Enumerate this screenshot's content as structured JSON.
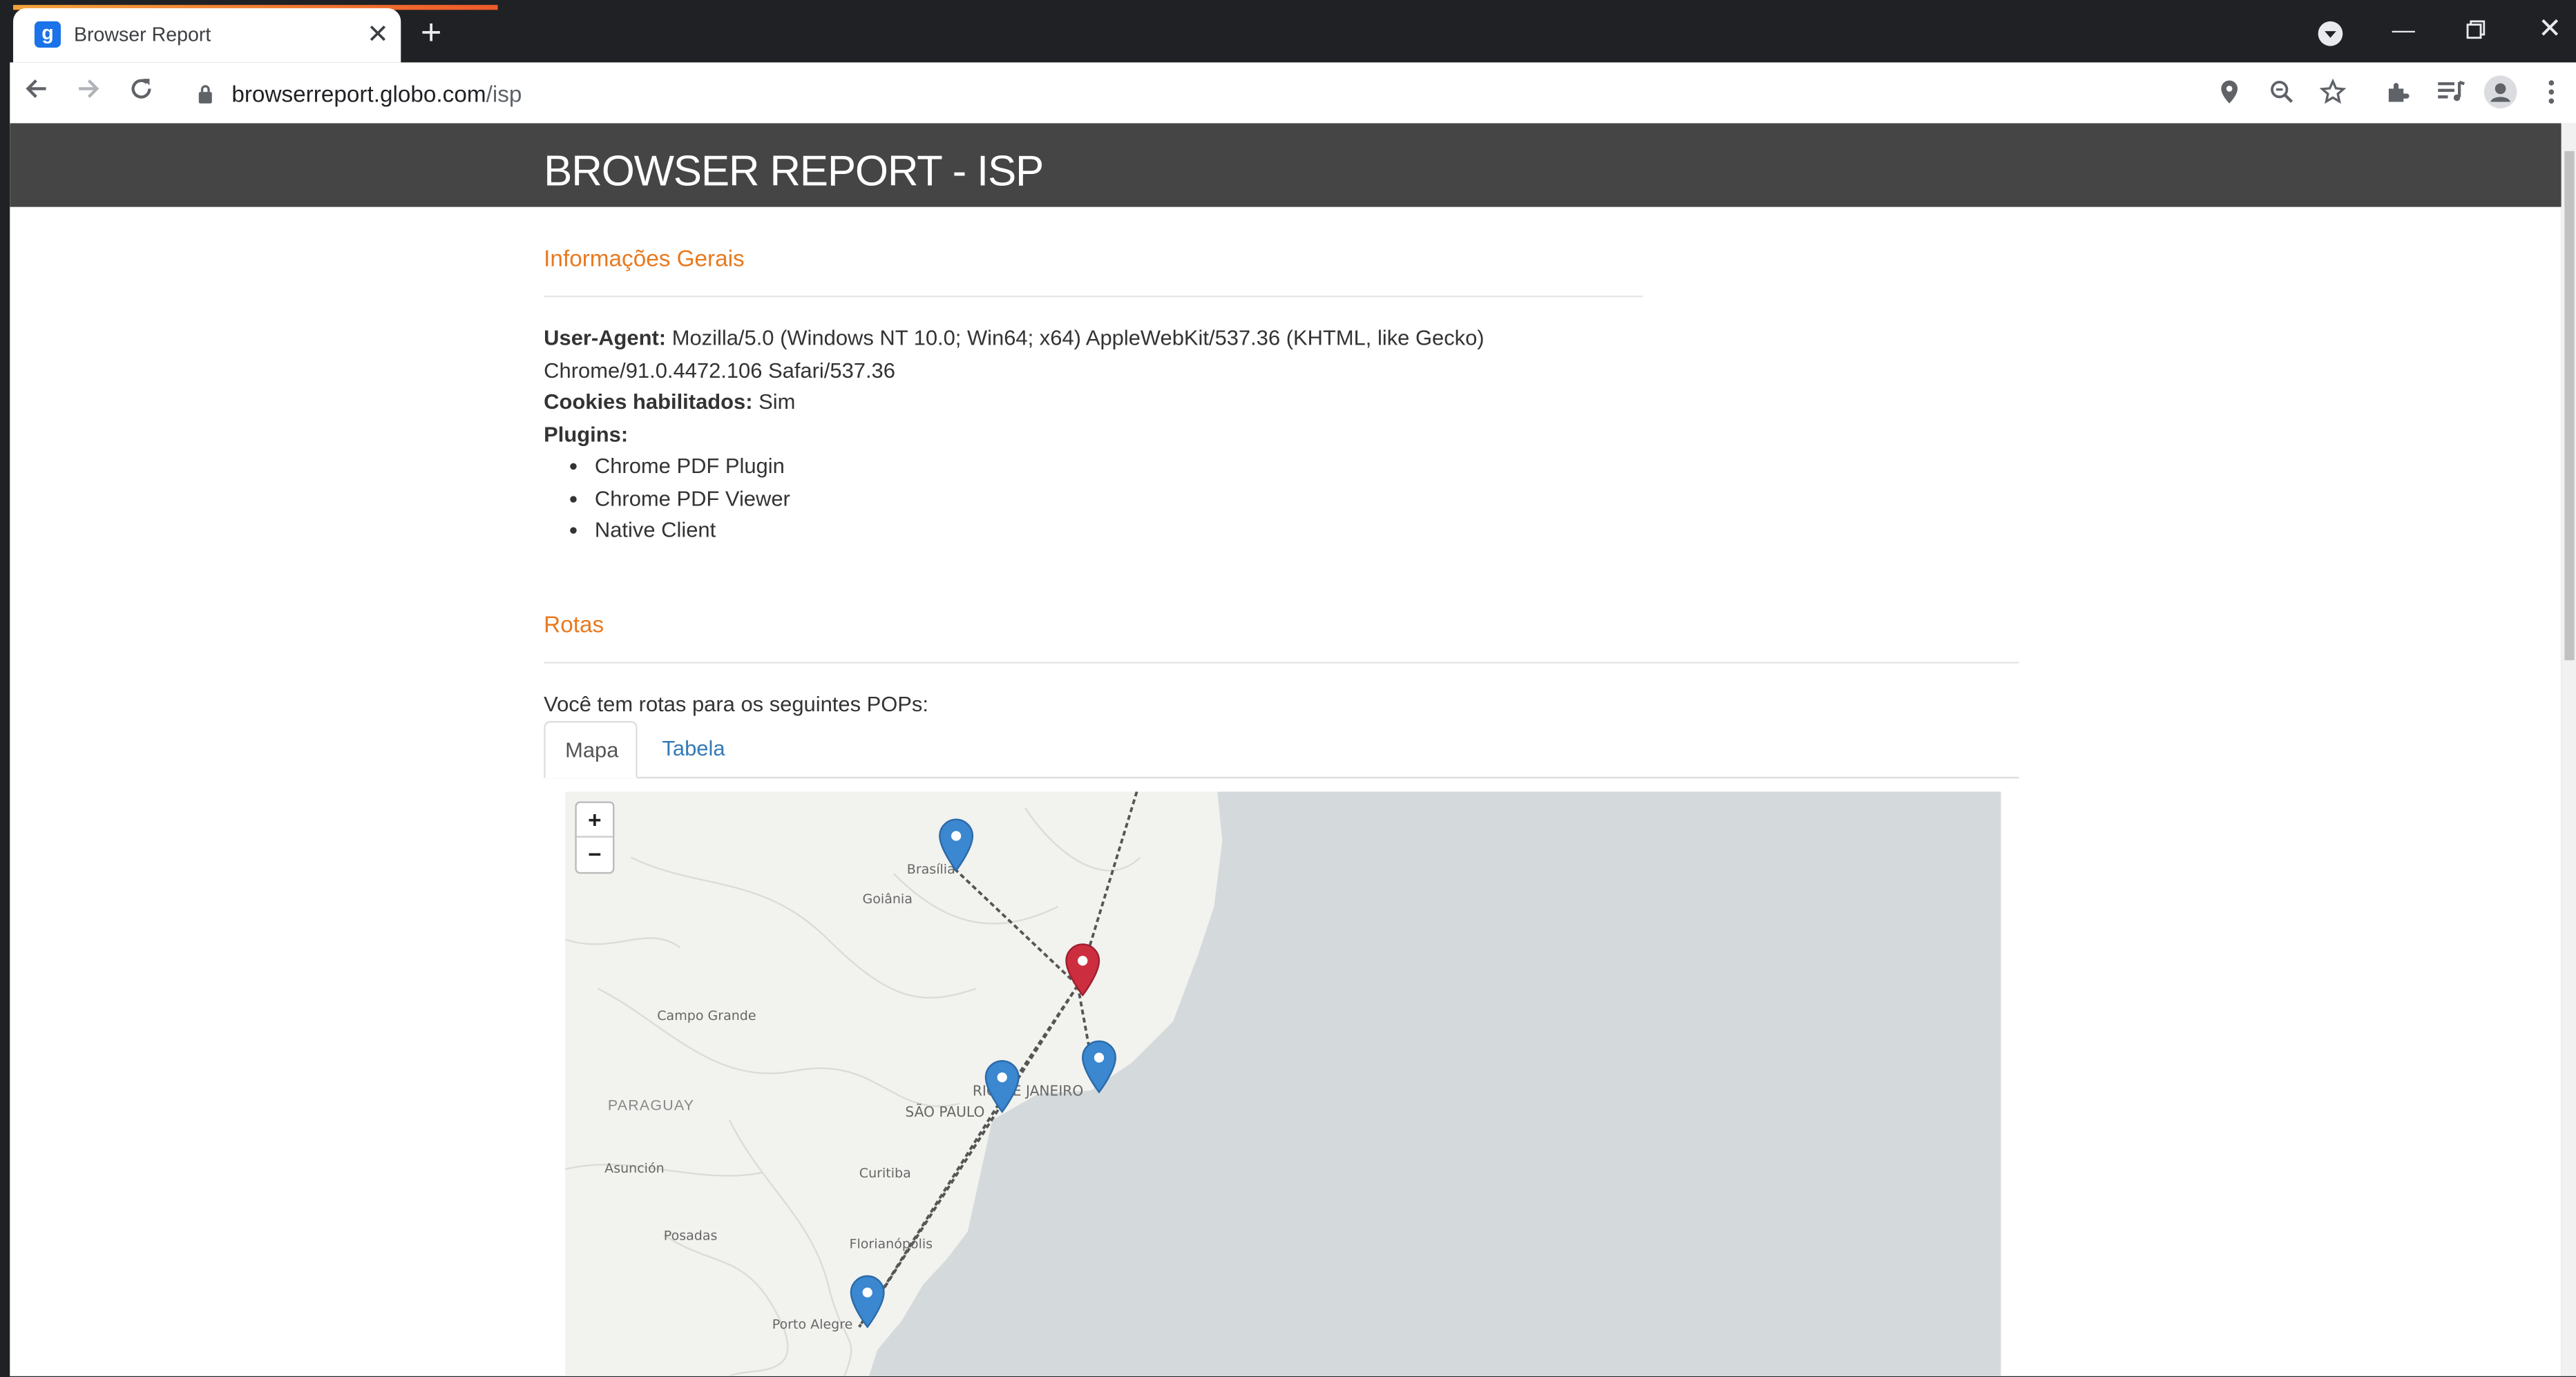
{
  "browser": {
    "tab_title": "Browser Report",
    "favicon_letter": "g",
    "url_host": "browserreport.globo.com",
    "url_path": "/isp"
  },
  "page": {
    "banner_title": "BROWSER REPORT - ISP",
    "general": {
      "title": "Informações Gerais",
      "ua_label": "User-Agent:",
      "ua_line1": " Mozilla/5.0 (Windows NT 10.0; Win64; x64) AppleWebKit/537.36 (KHTML, like Gecko)",
      "ua_line2": "Chrome/91.0.4472.106 Safari/537.36",
      "cookies_label": "Cookies habilitados:",
      "cookies_value": " Sim",
      "plugins_label": "Plugins:",
      "plugins": [
        "Chrome PDF Plugin",
        "Chrome PDF Viewer",
        "Native Client"
      ]
    },
    "routes": {
      "title": "Rotas",
      "intro": "Você tem rotas para os seguintes POPs:",
      "tabs": [
        "Mapa",
        "Tabela"
      ],
      "active_tab": "Mapa"
    },
    "map": {
      "zoom_in": "+",
      "zoom_out": "−",
      "labels": {
        "brasilia": "Brasília",
        "goiania": "Goiânia",
        "campo_grande": "Campo Grande",
        "paraguay": "PARAGUAY",
        "sao_paulo": "SÃO PAULO",
        "rio": "RIO DE JANEIRO",
        "curitiba": "Curitiba",
        "asuncion": "Asunción",
        "posadas": "Posadas",
        "florianopolis": "Florianópolis",
        "porto_alegre": "Porto Alegre"
      },
      "colors": {
        "pop_marker": "#3b87d0",
        "user_marker": "#cc2e3f",
        "ocean": "#d4dadc",
        "land": "#f2f2ef"
      }
    }
  }
}
